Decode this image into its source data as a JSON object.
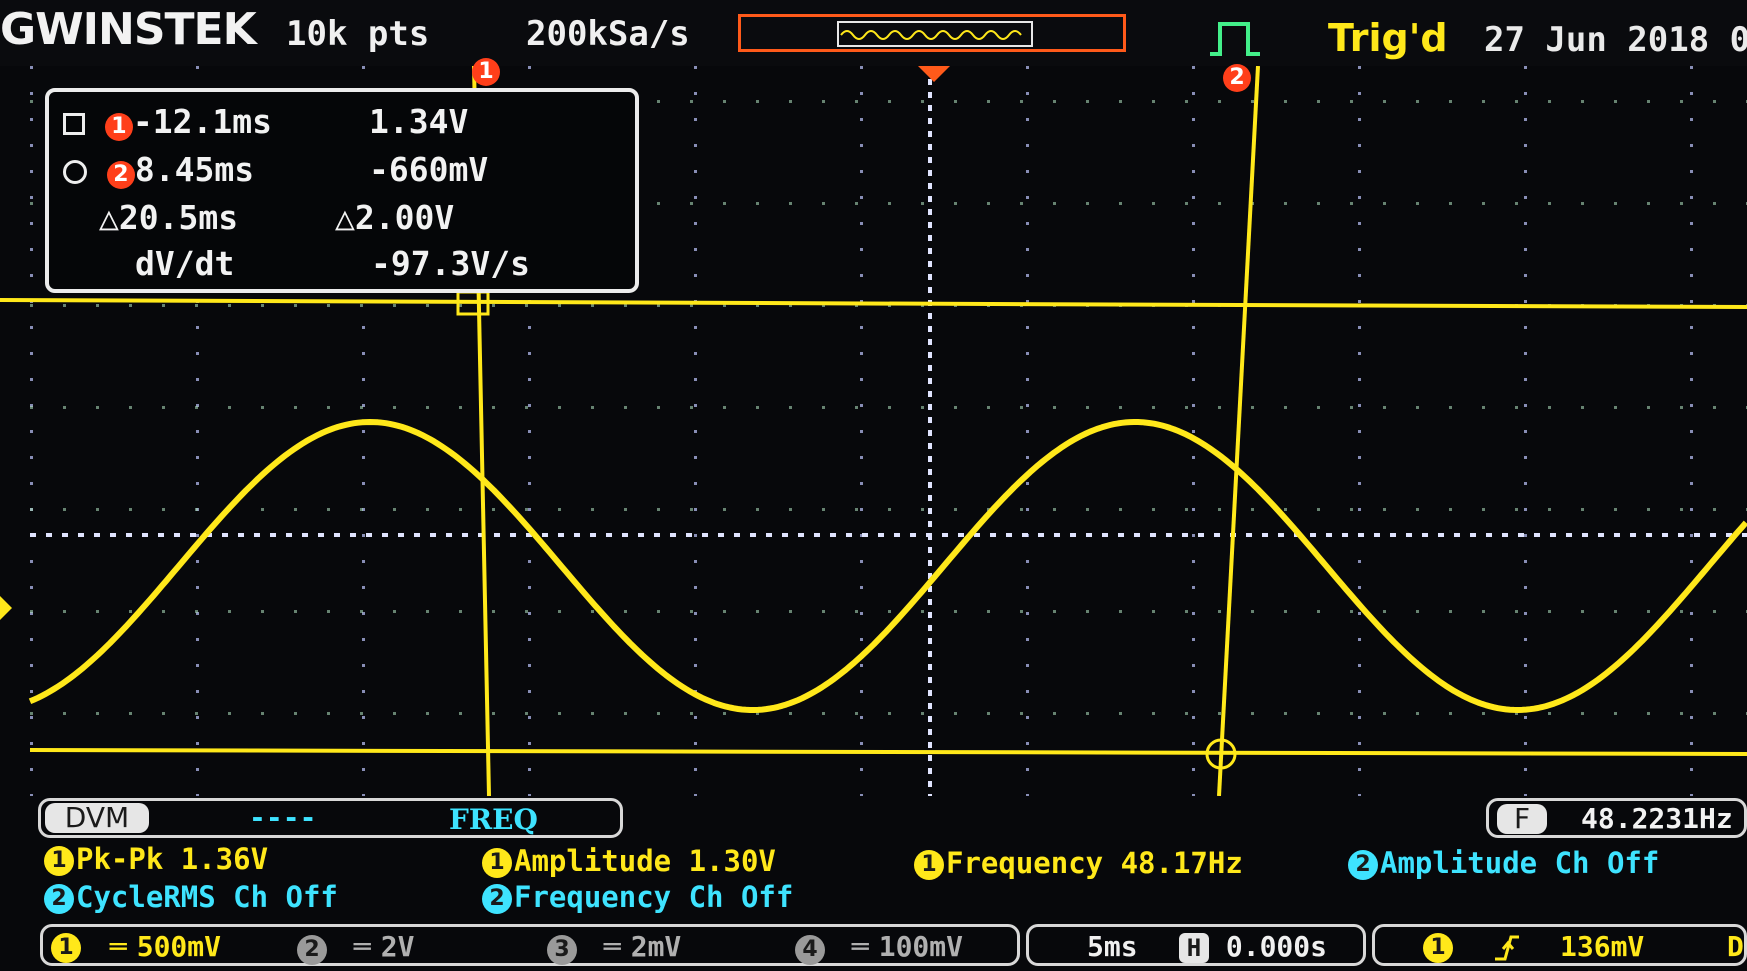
{
  "header": {
    "brand": "GWINSTEK",
    "record_length": "10k pts",
    "sample_rate": "200kSa/s",
    "trigger_state": "Trig'd",
    "date": "27 Jun 2018 0"
  },
  "cursors": {
    "row1": {
      "time": "-12.1ms",
      "volt": "1.34V",
      "badge": "1"
    },
    "row2": {
      "time": "8.45ms",
      "volt": "-660mV",
      "badge": "2"
    },
    "delta": {
      "time": "20.5ms",
      "volt": "2.00V"
    },
    "slope": {
      "label": "dV/dt",
      "value": "-97.3V/s"
    },
    "marker1": "1",
    "marker2": "2"
  },
  "dvm": {
    "label": "DVM",
    "dash": "----",
    "mode": "FREQ"
  },
  "freq_counter": {
    "label": "F",
    "value": "48.2231Hz"
  },
  "measurements": {
    "pkpk": "Pk-Pk 1.36V",
    "amplitude1": "Amplitude 1.30V",
    "frequency1": "Frequency 48.17Hz",
    "amplitude2": "Amplitude Ch Off",
    "cyclerms2": "CycleRMS Ch Off",
    "frequency2": "Frequency Ch Off",
    "ch1_num": "1",
    "ch2_num": "2"
  },
  "channels": {
    "ch1": {
      "num": "1",
      "scale": "500mV"
    },
    "ch2": {
      "num": "2",
      "scale": "2V"
    },
    "ch3": {
      "num": "3",
      "scale": "2mV"
    },
    "ch4": {
      "num": "4",
      "scale": "100mV"
    }
  },
  "horizontal": {
    "timebase": "5ms",
    "h_label": "H",
    "position": "0.000s"
  },
  "trigger": {
    "source": "1",
    "level": "136mV",
    "coupling": "D"
  },
  "colors": {
    "ch1": "#ffe81a",
    "ch2": "#3ee3ff",
    "cursor_marker": "#ff3f1a",
    "accent": "#ff5a1a"
  }
}
